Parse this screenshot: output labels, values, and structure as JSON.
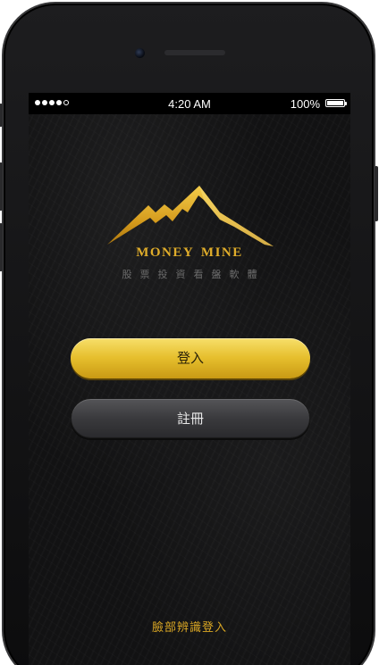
{
  "status_bar": {
    "time": "4:20 AM",
    "battery": "100%",
    "signal_icon": "signal-dots-icon",
    "battery_icon": "battery-full-icon"
  },
  "brand": {
    "name": "MONEY MINE",
    "tagline": "股票投資看盤軟體",
    "logo_icon": "mountain-logo-icon",
    "accent_color": "#e0ad2a"
  },
  "actions": {
    "login_label": "登入",
    "register_label": "註冊",
    "face_login_label": "臉部辨識登入"
  },
  "colors": {
    "login_button": "#e6bf2d",
    "register_button": "#3a3a3d",
    "background": "#121213"
  }
}
